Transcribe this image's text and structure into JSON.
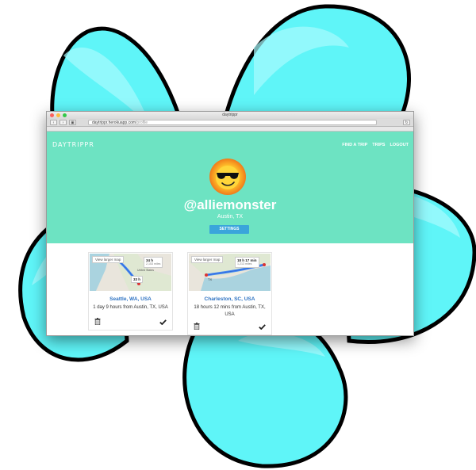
{
  "browser": {
    "window_title": "daytrippr",
    "url_host": "daytrippr.herokuapp.com",
    "url_path": "/profile"
  },
  "nav": {
    "logo": "DAYTRIPPR",
    "items": [
      "FIND A TRIP",
      "TRIPS",
      "LOGOUT"
    ]
  },
  "profile": {
    "username": "@alliemonster",
    "location": "Austin, TX",
    "settings_label": "SETTINGS"
  },
  "trips": [
    {
      "map_link": "View larger map",
      "duration_main": "34 h",
      "duration_sub": "2,153 miles",
      "duration_alt": "33 h",
      "destination": "Seattle, WA, USA",
      "from_text": "1 day 9 hours from Austin, TX, USA"
    },
    {
      "map_link": "View larger map",
      "duration_main": "18 h 17 min",
      "duration_sub": "1,213 miles",
      "destination": "Charleston, SC, USA",
      "from_text": "18 hours 12 mins from Austin, TX, USA"
    }
  ],
  "colors": {
    "hero": "#6de3c2",
    "petal": "#5ff5f8",
    "settings_button": "#3aa5db",
    "destination_link": "#2f73c3"
  },
  "icons": [
    "trash-icon",
    "check-icon",
    "sunglasses-sun-avatar"
  ]
}
